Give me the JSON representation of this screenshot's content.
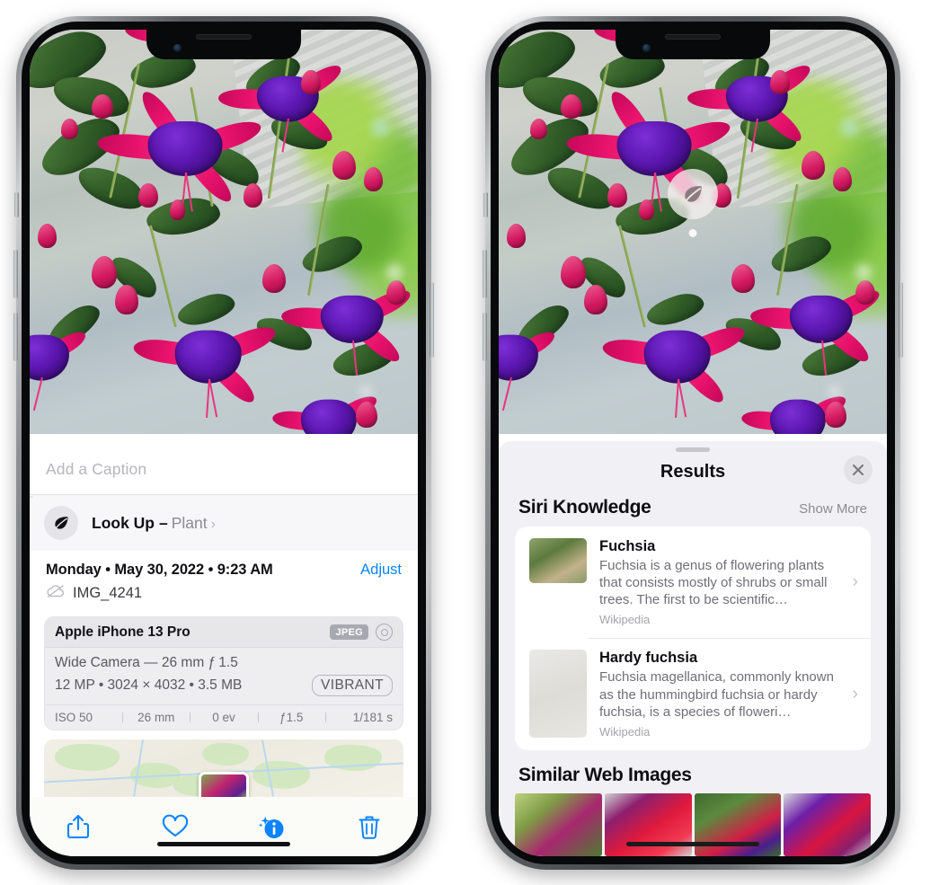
{
  "left_phone": {
    "caption_placeholder": "Add a Caption",
    "lookup": {
      "label": "Look Up",
      "dash": "–",
      "subject": "Plant",
      "chevron": "›",
      "icon": "leaf-icon"
    },
    "meta": {
      "date": "Monday • May 30, 2022 • 9:23 AM",
      "adjust": "Adjust",
      "filename": "IMG_4241",
      "cloud_icon": "icloud-slash-icon"
    },
    "camera": {
      "device": "Apple iPhone 13 Pro",
      "format_badge": "JPEG",
      "lens_icon": "lens-icon",
      "lens_line": "Wide Camera — 26 mm ƒ 1.5",
      "size_line": "12 MP • 3024 × 4032 • 3.5 MB",
      "style_badge": "VIBRANT",
      "exif": [
        "ISO 50",
        "26 mm",
        "0 ev",
        "ƒ1.5",
        "1/181 s"
      ]
    },
    "toolbar": [
      {
        "name": "share-button",
        "icon": "share-icon"
      },
      {
        "name": "favorite-button",
        "icon": "heart-icon"
      },
      {
        "name": "info-button",
        "icon": "info-sparkle-icon"
      },
      {
        "name": "delete-button",
        "icon": "trash-icon"
      }
    ],
    "accent_color": "#0a84ff"
  },
  "right_phone": {
    "bubble_icon": "leaf-icon",
    "panel": {
      "title": "Results",
      "close_icon": "close-icon",
      "siri_section": {
        "title": "Siri Knowledge",
        "show_more": "Show More"
      },
      "knowledge": [
        {
          "title": "Fuchsia",
          "desc": "Fuchsia is a genus of flowering plants that consists mostly of shrubs or small trees. The first to be scientific…",
          "source": "Wikipedia",
          "chevron": "›"
        },
        {
          "title": "Hardy fuchsia",
          "desc": "Fuchsia magellanica, commonly known as the hummingbird fuchsia or hardy fuchsia, is a species of floweri…",
          "source": "Wikipedia",
          "chevron": "›"
        }
      ],
      "web_section": {
        "title": "Similar Web Images"
      },
      "web_images": [
        "fuchsia-thumb-1",
        "fuchsia-thumb-2",
        "fuchsia-thumb-3",
        "fuchsia-thumb-4"
      ]
    }
  }
}
